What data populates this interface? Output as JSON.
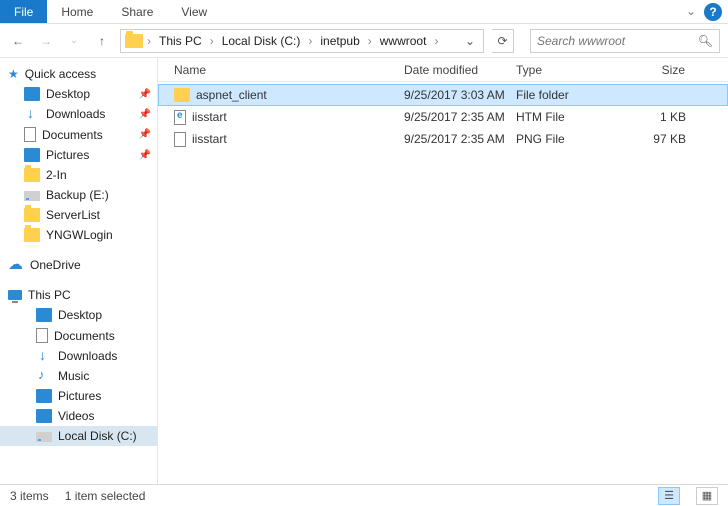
{
  "ribbon": {
    "tabs": [
      "File",
      "Home",
      "Share",
      "View"
    ]
  },
  "breadcrumb": [
    "This PC",
    "Local Disk (C:)",
    "inetpub",
    "wwwroot"
  ],
  "search_placeholder": "Search wwwroot",
  "columns": {
    "name": "Name",
    "date": "Date modified",
    "type": "Type",
    "size": "Size"
  },
  "files": [
    {
      "name": "aspnet_client",
      "date": "9/25/2017 3:03 AM",
      "type": "File folder",
      "size": "",
      "icon": "folder",
      "selected": true
    },
    {
      "name": "iisstart",
      "date": "9/25/2017 2:35 AM",
      "type": "HTM File",
      "size": "1 KB",
      "icon": "htm",
      "selected": false
    },
    {
      "name": "iisstart",
      "date": "9/25/2017 2:35 AM",
      "type": "PNG File",
      "size": "97 KB",
      "icon": "png",
      "selected": false
    }
  ],
  "sidebar": {
    "quick_access": {
      "label": "Quick access",
      "items": [
        {
          "label": "Desktop",
          "icon": "desktop",
          "pin": true
        },
        {
          "label": "Downloads",
          "icon": "downloads",
          "pin": true
        },
        {
          "label": "Documents",
          "icon": "documents",
          "pin": true
        },
        {
          "label": "Pictures",
          "icon": "pictures",
          "pin": true
        },
        {
          "label": "2-In",
          "icon": "folder",
          "pin": false
        },
        {
          "label": "Backup (E:)",
          "icon": "drive",
          "pin": false
        },
        {
          "label": "ServerList",
          "icon": "folder",
          "pin": false
        },
        {
          "label": "YNGWLogin",
          "icon": "folder",
          "pin": false
        }
      ]
    },
    "onedrive": {
      "label": "OneDrive"
    },
    "this_pc": {
      "label": "This PC",
      "items": [
        {
          "label": "Desktop",
          "icon": "desktop"
        },
        {
          "label": "Documents",
          "icon": "documents"
        },
        {
          "label": "Downloads",
          "icon": "downloads"
        },
        {
          "label": "Music",
          "icon": "music"
        },
        {
          "label": "Pictures",
          "icon": "pictures"
        },
        {
          "label": "Videos",
          "icon": "video"
        },
        {
          "label": "Local Disk (C:)",
          "icon": "drive",
          "selected": true
        }
      ]
    }
  },
  "status": {
    "count": "3 items",
    "selected": "1 item selected"
  }
}
